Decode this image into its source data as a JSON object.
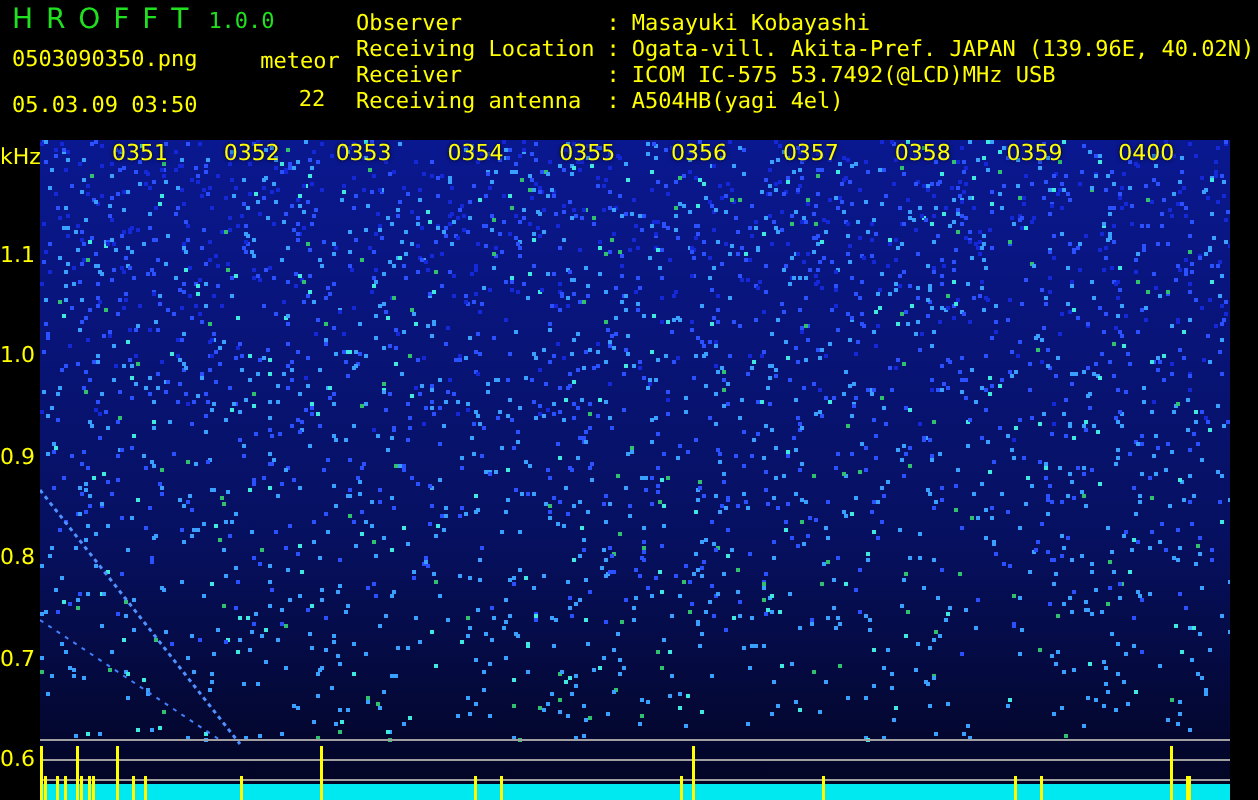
{
  "app": {
    "name": "H R O F F T",
    "version": "1.0.0"
  },
  "file": "0503090350.png",
  "timestamp": "05.03.09 03:50",
  "meteor": {
    "label": "meteor",
    "count": "22"
  },
  "info": [
    {
      "label": "Observer",
      "sep": ":",
      "value": "Masayuki Kobayashi"
    },
    {
      "label": "Receiving Location",
      "sep": ":",
      "value": "Ogata-vill. Akita-Pref. JAPAN (139.96E, 40.02N)"
    },
    {
      "label": "Receiver",
      "sep": ":",
      "value": "ICOM IC-575 53.7492(@LCD)MHz USB"
    },
    {
      "label": "Receiving antenna",
      "sep": ":",
      "value": "A504HB(yagi 4el)"
    }
  ],
  "axis": {
    "unit": "kHz",
    "y_labels": [
      "1.1",
      "1.0",
      "0.9",
      "0.8",
      "0.7",
      "0.6"
    ]
  },
  "time_labels": [
    "0351",
    "0352",
    "0353",
    "0354",
    "0355",
    "0356",
    "0357",
    "0358",
    "0359",
    "0400"
  ]
}
